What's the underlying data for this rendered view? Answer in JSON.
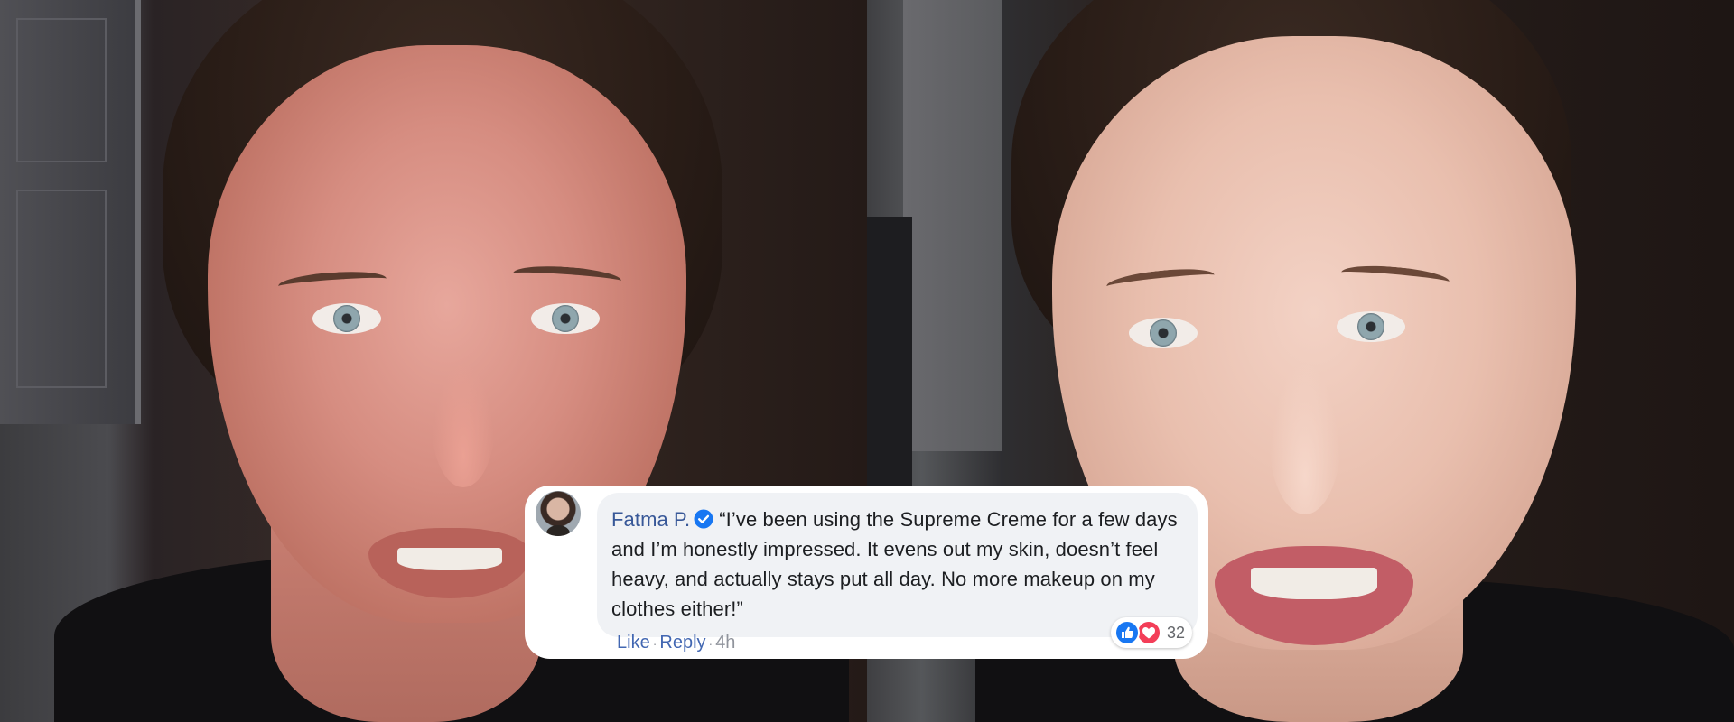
{
  "photos": {
    "before_alt": "Woman's face before",
    "after_alt": "Woman's face after"
  },
  "comment": {
    "author": "Fatma P.",
    "verified_icon": "verified-check-icon",
    "text": "“I’ve been using the Supreme Creme for a few days and I’m honestly impressed. It evens out my skin, doesn’t feel heavy, and actually stays put all day. No more makeup on my clothes either!”",
    "reactions": {
      "icons": [
        "like-react-icon",
        "love-react-icon"
      ],
      "count": "32"
    },
    "actions": {
      "like": "Like",
      "separator": "·",
      "reply": "Reply",
      "time": "4h"
    }
  },
  "colors": {
    "link": "#385898",
    "bubble": "#f0f2f5",
    "like_blue": "#1877f2",
    "love_red": "#f33e58",
    "muted": "#90949c"
  }
}
